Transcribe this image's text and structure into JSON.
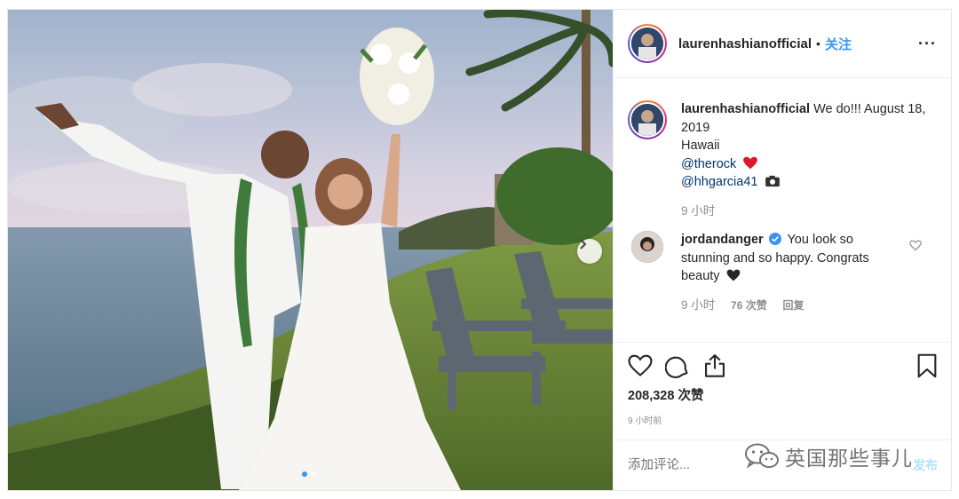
{
  "post": {
    "author": "laurenhashianofficial",
    "follow_label": "关注",
    "separator": "•",
    "more_label": "···",
    "caption_text": "We do!!! August 18, 2019",
    "caption_location": "Hawaii",
    "caption_mention_1": "@therock",
    "caption_mention_2": "@hhgarcia41",
    "caption_time": "9 小时",
    "comment": {
      "author": "jordandanger",
      "text": "You look so stunning and so happy. Congrats beauty",
      "time": "9 小时",
      "likes": "76 次赞",
      "reply_label": "回复"
    },
    "likes_text": "208,328 次赞",
    "posted_ago": "9 小时前",
    "add_comment_placeholder": "添加评论...",
    "post_button": "发布",
    "carousel": {
      "slides": 2,
      "active": 1
    }
  },
  "watermark": {
    "text": "英国那些事儿"
  },
  "icons": {
    "like": "heart-icon",
    "comment": "comment-bubble-icon",
    "share": "share-icon",
    "save": "bookmark-icon",
    "verified": "verified-badge-icon",
    "next": "chevron-right-icon"
  },
  "colors": {
    "link": "#3897f0",
    "mention": "#00376b",
    "muted": "#8e8e8e",
    "text": "#262626"
  }
}
